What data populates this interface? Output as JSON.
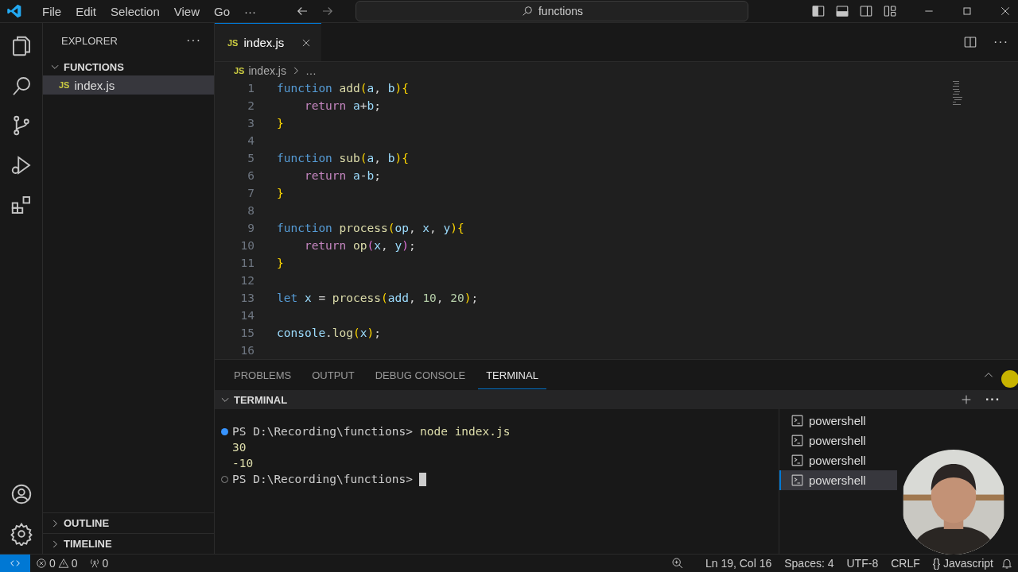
{
  "menu": [
    "File",
    "Edit",
    "Selection",
    "View",
    "Go",
    "···"
  ],
  "search": {
    "value": "functions"
  },
  "sidebar": {
    "title": "EXPLORER",
    "more": "···",
    "folder": {
      "label": "FUNCTIONS",
      "expanded": true,
      "children": [
        {
          "badge": "JS",
          "label": "index.js",
          "selected": true
        }
      ]
    },
    "sections": [
      {
        "label": "OUTLINE",
        "expanded": false
      },
      {
        "label": "TIMELINE",
        "expanded": false
      }
    ]
  },
  "tabs": [
    {
      "badge": "JS",
      "label": "index.js",
      "selected": true
    }
  ],
  "editor_more": "···",
  "breadcrumb": {
    "badge": "JS",
    "file": "index.js",
    "rest": "…"
  },
  "code": [
    {
      "number": "1",
      "indented": false,
      "tokens": [
        {
          "kind": "keyword",
          "t": "function "
        },
        {
          "kind": "fn",
          "t": "add"
        },
        {
          "kind": "paren",
          "t": "("
        },
        {
          "kind": "param",
          "t": "a"
        },
        {
          "kind": "plain",
          "t": ", "
        },
        {
          "kind": "param",
          "t": "b"
        },
        {
          "kind": "paren",
          "t": ")"
        },
        {
          "kind": "brace",
          "t": "{"
        }
      ]
    },
    {
      "number": "2",
      "indented": true,
      "tokens": [
        {
          "kind": "control",
          "t": "return "
        },
        {
          "kind": "param",
          "t": "a"
        },
        {
          "kind": "plain",
          "t": "+"
        },
        {
          "kind": "param",
          "t": "b"
        },
        {
          "kind": "plain",
          "t": ";"
        }
      ]
    },
    {
      "number": "3",
      "indented": false,
      "tokens": [
        {
          "kind": "brace",
          "t": "}"
        }
      ]
    },
    {
      "number": "4"
    },
    {
      "number": "5",
      "indented": false,
      "tokens": [
        {
          "kind": "keyword",
          "t": "function "
        },
        {
          "kind": "fn",
          "t": "sub"
        },
        {
          "kind": "paren",
          "t": "("
        },
        {
          "kind": "param",
          "t": "a"
        },
        {
          "kind": "plain",
          "t": ", "
        },
        {
          "kind": "param",
          "t": "b"
        },
        {
          "kind": "paren",
          "t": ")"
        },
        {
          "kind": "brace",
          "t": "{"
        }
      ]
    },
    {
      "number": "6",
      "indented": true,
      "tokens": [
        {
          "kind": "control",
          "t": "return "
        },
        {
          "kind": "param",
          "t": "a"
        },
        {
          "kind": "plain",
          "t": "-"
        },
        {
          "kind": "param",
          "t": "b"
        },
        {
          "kind": "plain",
          "t": ";"
        }
      ]
    },
    {
      "number": "7",
      "indented": false,
      "tokens": [
        {
          "kind": "brace",
          "t": "}"
        }
      ]
    },
    {
      "number": "8"
    },
    {
      "number": "9",
      "indented": false,
      "tokens": [
        {
          "kind": "keyword",
          "t": "function "
        },
        {
          "kind": "fn",
          "t": "process"
        },
        {
          "kind": "paren",
          "t": "("
        },
        {
          "kind": "param",
          "t": "op"
        },
        {
          "kind": "plain",
          "t": ", "
        },
        {
          "kind": "param",
          "t": "x"
        },
        {
          "kind": "plain",
          "t": ", "
        },
        {
          "kind": "param",
          "t": "y"
        },
        {
          "kind": "paren",
          "t": ")"
        },
        {
          "kind": "brace",
          "t": "{"
        }
      ]
    },
    {
      "number": "10",
      "indented": true,
      "tokens": [
        {
          "kind": "control",
          "t": "return "
        },
        {
          "kind": "fn",
          "t": "op"
        },
        {
          "kind": "paren2",
          "t": "("
        },
        {
          "kind": "param",
          "t": "x"
        },
        {
          "kind": "plain",
          "t": ", "
        },
        {
          "kind": "param",
          "t": "y"
        },
        {
          "kind": "paren2",
          "t": ")"
        },
        {
          "kind": "plain",
          "t": ";"
        }
      ]
    },
    {
      "number": "11",
      "indented": false,
      "tokens": [
        {
          "kind": "brace",
          "t": "}"
        }
      ]
    },
    {
      "number": "12"
    },
    {
      "number": "13",
      "indented": false,
      "tokens": [
        {
          "kind": "keyword",
          "t": "let "
        },
        {
          "kind": "param",
          "t": "x"
        },
        {
          "kind": "plain",
          "t": " = "
        },
        {
          "kind": "fn",
          "t": "process"
        },
        {
          "kind": "paren",
          "t": "("
        },
        {
          "kind": "param",
          "t": "add"
        },
        {
          "kind": "plain",
          "t": ", "
        },
        {
          "kind": "number",
          "t": "10"
        },
        {
          "kind": "plain",
          "t": ", "
        },
        {
          "kind": "number",
          "t": "20"
        },
        {
          "kind": "paren",
          "t": ")"
        },
        {
          "kind": "plain",
          "t": ";"
        }
      ]
    },
    {
      "number": "14"
    },
    {
      "number": "15",
      "indented": false,
      "tokens": [
        {
          "kind": "param",
          "t": "console"
        },
        {
          "kind": "plain",
          "t": "."
        },
        {
          "kind": "fn",
          "t": "log"
        },
        {
          "kind": "paren",
          "t": "("
        },
        {
          "kind": "param",
          "t": "x"
        },
        {
          "kind": "paren",
          "t": ")"
        },
        {
          "kind": "plain",
          "t": ";"
        }
      ]
    },
    {
      "number": "16"
    }
  ],
  "panel_tabs": [
    {
      "label": "PROBLEMS",
      "selected": false
    },
    {
      "label": "OUTPUT",
      "selected": false
    },
    {
      "label": "DEBUG CONSOLE",
      "selected": false
    },
    {
      "label": "TERMINAL",
      "selected": true
    }
  ],
  "terminal": {
    "title": "TERMINAL",
    "expanded": true,
    "more": "···",
    "lines": [
      {
        "kind": "prompt",
        "succeeded": true,
        "prompt": "PS D:\\Recording\\functions>",
        "command": "node index.js"
      },
      {
        "kind": "output",
        "text": "30"
      },
      {
        "kind": "output",
        "text": "-10"
      },
      {
        "kind": "prompt",
        "succeeded": false,
        "prompt": "PS D:\\Recording\\functions>",
        "cursor": true
      }
    ],
    "sessions": [
      {
        "label": "powershell",
        "selected": false
      },
      {
        "label": "powershell",
        "selected": false
      },
      {
        "label": "powershell",
        "selected": false
      },
      {
        "label": "powershell",
        "selected": true
      }
    ]
  },
  "status_bar": {
    "errors": "0",
    "warnings": "0",
    "ports": "0",
    "right": [
      "Ln 19, Col 16",
      "Spaces: 4",
      "UTF-8",
      "CRLF"
    ],
    "language": "{} Javascript"
  },
  "webcam": {
    "kind": "picture"
  }
}
